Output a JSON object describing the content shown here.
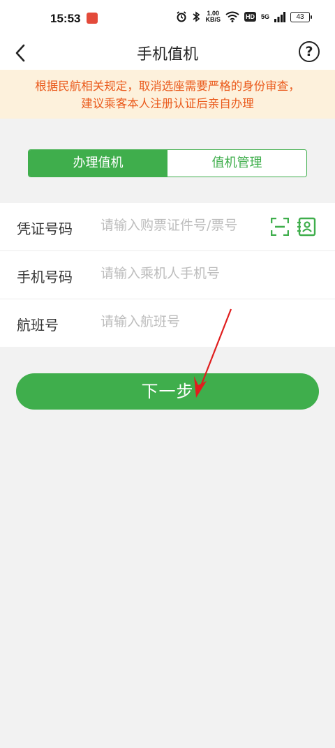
{
  "status_bar": {
    "time": "15:53",
    "net_speed_value": "1.00",
    "net_speed_unit": "KB/S",
    "hd_label": "HD",
    "network_label": "5G",
    "battery": "43"
  },
  "header": {
    "title": "手机值机"
  },
  "notice": {
    "line1": "根据民航相关规定，取消选座需要严格的身份审查，",
    "line2": "建议乘客本人注册认证后亲自办理"
  },
  "tabs": [
    {
      "label": "办理值机",
      "active": true
    },
    {
      "label": "值机管理",
      "active": false
    }
  ],
  "form": {
    "credential": {
      "label": "凭证号码",
      "placeholder": "请输入购票证件号/票号",
      "value": ""
    },
    "phone": {
      "label": "手机号码",
      "placeholder": "请输入乘机人手机号",
      "value": ""
    },
    "flight": {
      "label": "航班号",
      "placeholder": "请输入航班号",
      "value": ""
    }
  },
  "next_button": {
    "label": "下一步"
  },
  "colors": {
    "accent": "#3fae4c",
    "notice_text": "#ea5a1c",
    "notice_bg": "#fdf1dc",
    "annotation_arrow": "#e01e1e"
  },
  "icons": [
    "back-arrow-icon",
    "help-icon",
    "scan-icon",
    "contact-card-icon",
    "alarm-icon",
    "bluetooth-icon",
    "wifi-icon",
    "signal-icon",
    "battery-icon"
  ]
}
